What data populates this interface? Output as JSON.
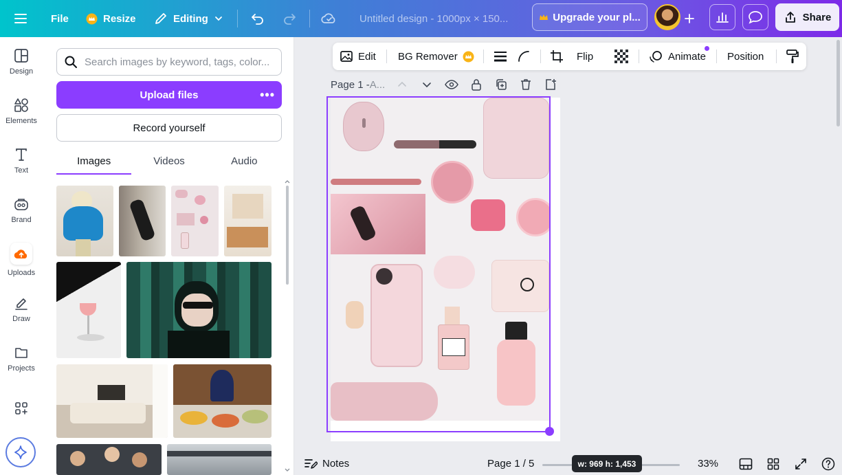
{
  "topbar": {
    "file_label": "File",
    "resize_label": "Resize",
    "mode_label": "Editing",
    "doc_title": "Untitled design - 1000px × 150...",
    "upgrade_label": "Upgrade your pl...",
    "share_label": "Share"
  },
  "rail": {
    "items": [
      {
        "label": "Design",
        "icon": "layout-icon"
      },
      {
        "label": "Elements",
        "icon": "shapes-icon"
      },
      {
        "label": "Text",
        "icon": "text-icon"
      },
      {
        "label": "Brand",
        "icon": "brand-icon"
      },
      {
        "label": "Uploads",
        "icon": "cloud-upload-icon"
      },
      {
        "label": "Draw",
        "icon": "pen-icon"
      },
      {
        "label": "Projects",
        "icon": "folder-icon"
      },
      {
        "label": "",
        "icon": "apps-icon"
      }
    ]
  },
  "panel": {
    "search_placeholder": "Search images by keyword, tags, color...",
    "upload_label": "Upload files",
    "upload_more": "•••",
    "record_label": "Record yourself",
    "tabs": [
      "Images",
      "Videos",
      "Audio"
    ],
    "active_tab": "Images"
  },
  "toolbar": {
    "edit_label": "Edit",
    "bg_remover_label": "BG Remover",
    "flip_label": "Flip",
    "animate_label": "Animate",
    "position_label": "Position"
  },
  "page": {
    "title": "Page 1 - ",
    "subtitle": "A..."
  },
  "bottom": {
    "notes_label": "Notes",
    "page_indicator": "Page 1 / 5",
    "size_tooltip": "w: 969 h: 1,453",
    "zoom": "33%"
  },
  "colors": {
    "accent": "#8b3dff",
    "gradient_start": "#00c4cc",
    "gradient_end": "#7d2ae8",
    "uploads_icon": "#ff6a00",
    "crown": "#f9b417"
  }
}
